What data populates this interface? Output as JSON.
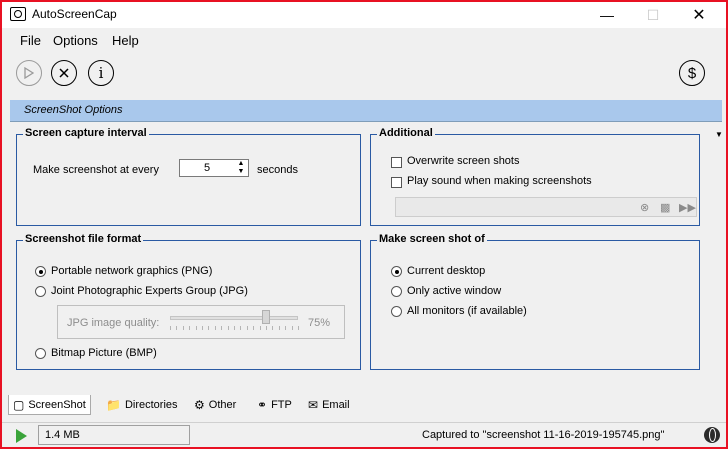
{
  "window": {
    "title": "AutoScreenCap"
  },
  "menu": {
    "file": "File",
    "options": "Options",
    "help": "Help"
  },
  "toolbar": {
    "start": {
      "icon": "play-icon",
      "disabled": true
    },
    "stop": {
      "icon": "close-circle-icon"
    },
    "info": {
      "icon": "info-icon",
      "glyph": "i"
    },
    "donate": {
      "icon": "dollar-icon",
      "glyph": "$"
    }
  },
  "section": {
    "title": "ScreenShot Options"
  },
  "capture_interval": {
    "title": "Screen capture interval",
    "prefix": "Make screenshot at every",
    "value": "5",
    "suffix": "seconds"
  },
  "additional": {
    "title": "Additional",
    "overwrite": {
      "label": "Overwrite screen shots",
      "checked": false
    },
    "sound": {
      "label": "Play sound when making screenshots",
      "checked": false
    },
    "sound_path": ""
  },
  "file_format": {
    "title": "Screenshot file format",
    "options": [
      {
        "label": "Portable network graphics (PNG)",
        "checked": true
      },
      {
        "label": "Joint Photographic Experts Group (JPG)",
        "checked": false
      },
      {
        "label": "Bitmap Picture (BMP)",
        "checked": false
      }
    ],
    "jpg_quality": {
      "label": "JPG image quality:",
      "value": "75%",
      "level": 0.75
    }
  },
  "make_shot_of": {
    "title": "Make screen shot of",
    "options": [
      {
        "label": "Current desktop",
        "checked": true
      },
      {
        "label": "Only active window",
        "checked": false
      },
      {
        "label": "All monitors (if available)",
        "checked": false
      }
    ]
  },
  "tabs": [
    {
      "label": "ScreenShot",
      "icon": "screenshot-icon",
      "active": true
    },
    {
      "label": "Directories",
      "icon": "folder-icon",
      "active": false
    },
    {
      "label": "Other",
      "icon": "gear-icon",
      "active": false
    },
    {
      "label": "FTP",
      "icon": "key-icon",
      "active": false
    },
    {
      "label": "Email",
      "icon": "envelope-icon",
      "active": false
    }
  ],
  "status": {
    "size": "1.4 MB",
    "captured": "Captured to \"screenshot 11-16-2019-195745.png\""
  },
  "colors": {
    "header_band": "#a9c8ec",
    "group_border": "#2a5aa3",
    "window_border": "#e81123",
    "play_green": "#3aa33a"
  }
}
